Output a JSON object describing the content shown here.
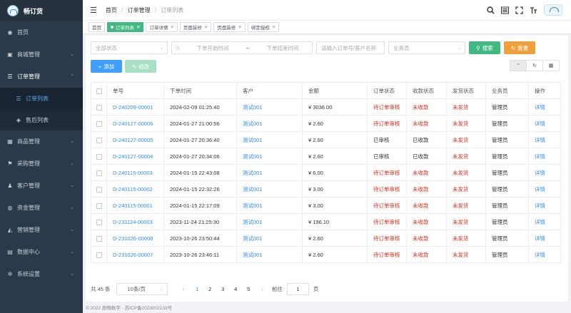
{
  "brand": {
    "name": "畅订货"
  },
  "sidebar": {
    "items": [
      {
        "label": "首页",
        "icon": "dashboard-icon",
        "glyph": "◉",
        "chev": ""
      },
      {
        "label": "商城管理",
        "icon": "shop-icon",
        "glyph": "▣",
        "chev": "⌄"
      },
      {
        "label": "订单管理",
        "icon": "list-icon",
        "glyph": "☰",
        "chev": "⌃"
      },
      {
        "label": "订单列表",
        "icon": "list-icon",
        "glyph": "☰"
      },
      {
        "label": "售后列表",
        "icon": "gift-icon",
        "glyph": "◈"
      },
      {
        "label": "商品管理",
        "icon": "box-icon",
        "glyph": "▦",
        "chev": "⌄"
      },
      {
        "label": "采购管理",
        "icon": "flag-icon",
        "glyph": "⚑",
        "chev": "⌄"
      },
      {
        "label": "客户管理",
        "icon": "users-icon",
        "glyph": "♟",
        "chev": "⌄"
      },
      {
        "label": "资金管理",
        "icon": "money-icon",
        "glyph": "◍",
        "chev": "⌄"
      },
      {
        "label": "营销管理",
        "icon": "megaphone-icon",
        "glyph": "◭",
        "chev": "⌄"
      },
      {
        "label": "数据中心",
        "icon": "chart-icon",
        "glyph": "▤",
        "chev": "⌄"
      },
      {
        "label": "系统设置",
        "icon": "gear-icon",
        "glyph": "✲",
        "chev": "⌄"
      }
    ]
  },
  "breadcrumb": {
    "a": "首页",
    "b": "订单管理",
    "c": "订单列表",
    "sep": "/"
  },
  "topbar": {
    "icons": [
      "search-icon",
      "news-icon",
      "fullscreen-icon",
      "font-size-icon"
    ]
  },
  "tabs": [
    {
      "label": "首页",
      "closable": false,
      "active": false
    },
    {
      "label": "订单列表",
      "closable": true,
      "active": true
    },
    {
      "label": "订单详情",
      "closable": true,
      "active": false
    },
    {
      "label": "页面装修",
      "closable": true,
      "active": false
    },
    {
      "label": "页面装修",
      "closable": true,
      "active": false
    },
    {
      "label": "绑定授权",
      "closable": true,
      "active": false
    }
  ],
  "filter": {
    "status_placeholder": "全部状态",
    "start_placeholder": "下单开始时间",
    "range_sep": "~",
    "end_placeholder": "下单结束时间",
    "keyword_placeholder": "请输入订单号/客户名称",
    "salesman_placeholder": "业务员",
    "search_label": "搜索",
    "reset_label": "重置"
  },
  "toolbar": {
    "add_label": "添加",
    "edit_label": "修改"
  },
  "table": {
    "columns": [
      "单号",
      "下单时间",
      "客户",
      "金额",
      "订单状态",
      "收款状态",
      "发货状态",
      "业务员",
      "操作"
    ],
    "rows": [
      {
        "no": "D-240209-00001",
        "time": "2024-02-09 01:25:40",
        "customer": "测试001",
        "amount": "¥ 3036.00",
        "order_status": "待订单审核",
        "pay_status": "未收款",
        "ship_status": "未发货",
        "salesman": "管理员",
        "op": "详情",
        "os_red": true,
        "ps_red": true
      },
      {
        "no": "D-240127-00006",
        "time": "2024-01-27 21:00:56",
        "customer": "测试001",
        "amount": "¥ 2.60",
        "order_status": "待订单审核",
        "pay_status": "未收款",
        "ship_status": "未发货",
        "salesman": "管理员",
        "op": "详情",
        "os_red": true,
        "ps_red": true
      },
      {
        "no": "D-240127-00005",
        "time": "2024-01-27 20:36:40",
        "customer": "测试001",
        "amount": "¥ 2.60",
        "order_status": "已审核",
        "pay_status": "已收款",
        "ship_status": "未发货",
        "salesman": "管理员",
        "op": "详情",
        "os_red": false,
        "ps_red": false
      },
      {
        "no": "D-240127-00004",
        "time": "2024-01-27 20:34:06",
        "customer": "测试001",
        "amount": "¥ 2.60",
        "order_status": "已审核",
        "pay_status": "已收款",
        "ship_status": "未发货",
        "salesman": "管理员",
        "op": "详情",
        "os_red": false,
        "ps_red": false
      },
      {
        "no": "D-240115-00003",
        "time": "2024-01-15 22:43:08",
        "customer": "测试001",
        "amount": "¥ 6.00",
        "order_status": "待订单审核",
        "pay_status": "未收款",
        "ship_status": "未发货",
        "salesman": "管理员",
        "op": "详情",
        "os_red": true,
        "ps_red": true
      },
      {
        "no": "D-240115-00002",
        "time": "2024-01-15 22:32:26",
        "customer": "测试001",
        "amount": "¥ 3.00",
        "order_status": "待订单审核",
        "pay_status": "未收款",
        "ship_status": "未发货",
        "salesman": "管理员",
        "op": "详情",
        "os_red": true,
        "ps_red": true
      },
      {
        "no": "D-240115-00001",
        "time": "2024-01-15 22:17:09",
        "customer": "测试001",
        "amount": "¥ 3.00",
        "order_status": "待订单审核",
        "pay_status": "未收款",
        "ship_status": "未发货",
        "salesman": "管理员",
        "op": "详情",
        "os_red": true,
        "ps_red": true
      },
      {
        "no": "D-231124-00003",
        "time": "2023-11-24 21:25:30",
        "customer": "测试001",
        "amount": "¥ 196.10",
        "order_status": "待订单审核",
        "pay_status": "未收款",
        "ship_status": "未发货",
        "salesman": "管理员",
        "op": "详情",
        "os_red": true,
        "ps_red": true
      },
      {
        "no": "D-231026-00008",
        "time": "2023-10-26 23:50:44",
        "customer": "测试001",
        "amount": "¥ 2.60",
        "order_status": "待订单审核",
        "pay_status": "未收款",
        "ship_status": "未发货",
        "salesman": "管理员",
        "op": "详情",
        "os_red": true,
        "ps_red": true
      },
      {
        "no": "D-231026-00007",
        "time": "2023-10-26 23:46:11",
        "customer": "测试001",
        "amount": "¥ 2.60",
        "order_status": "待订单审核",
        "pay_status": "未收款",
        "ship_status": "未发货",
        "salesman": "管理员",
        "op": "详情",
        "os_red": true,
        "ps_red": true
      }
    ]
  },
  "pager": {
    "total": "共 45 条",
    "page_size": "10条/页",
    "pages": [
      "1",
      "2",
      "3",
      "4",
      "5"
    ],
    "current": "1",
    "goto_label": "前往",
    "goto_value": "1",
    "page_unit": "页"
  },
  "footer": {
    "text": "© 2022 辰畅数字 · 苏ICP备2023002133号"
  },
  "colors": {
    "sidebar": "#2b3a4a",
    "accent_green": "#42b983",
    "accent_orange": "#f0a03b",
    "primary_blue": "#409eff",
    "link": "#2d8cf0",
    "status_red": "#e0301e"
  }
}
